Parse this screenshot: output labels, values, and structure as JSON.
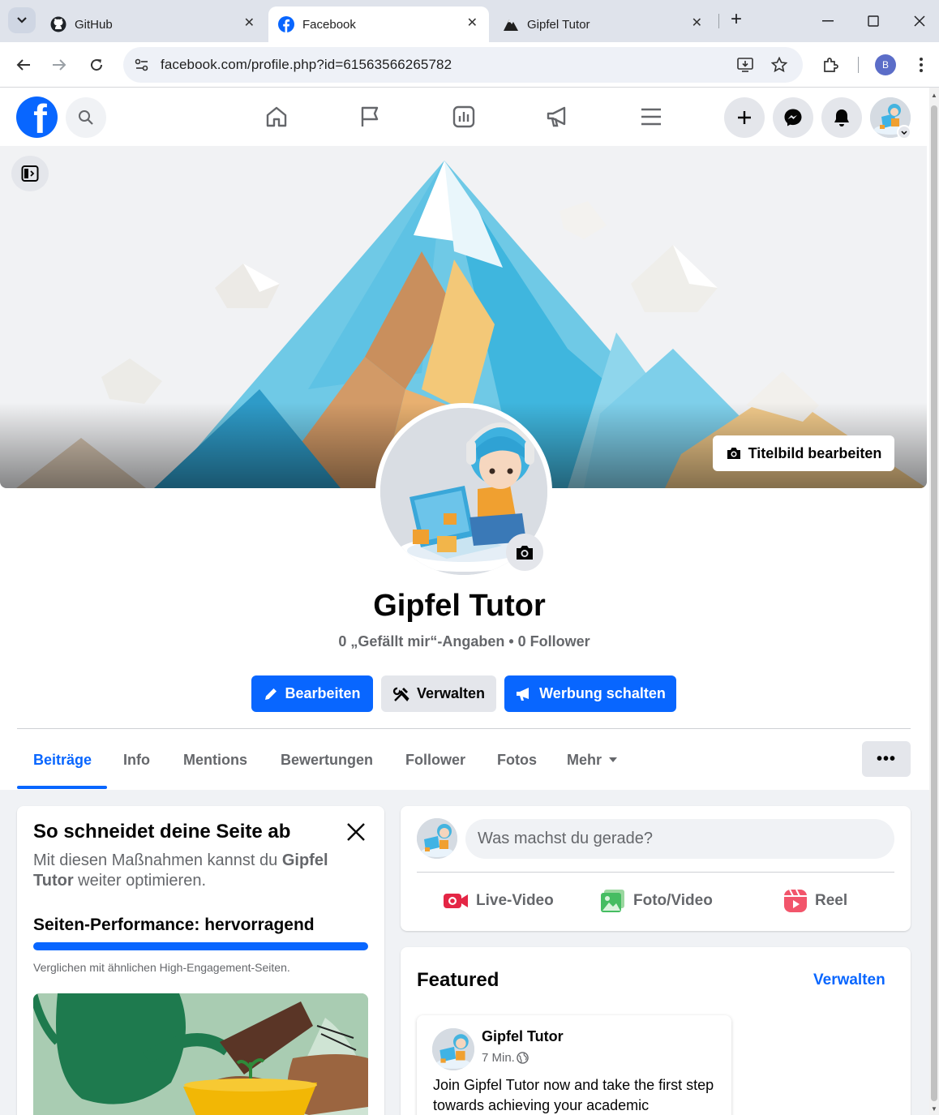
{
  "browser": {
    "tabs": [
      {
        "title": "GitHub",
        "icon": "github-icon"
      },
      {
        "title": "Facebook",
        "icon": "facebook-icon",
        "active": true
      },
      {
        "title": "Gipfel Tutor",
        "icon": "mountain-icon"
      }
    ],
    "new_tab": "+",
    "url": "facebook.com/profile.php?id=61563566265782",
    "profile_initial": "B"
  },
  "profile": {
    "name": "Gipfel Tutor",
    "stats": "0 „Gefällt mir“-Angaben • 0 Follower",
    "cover_edit_label": "Titelbild bearbeiten",
    "buttons": {
      "edit": "Bearbeiten",
      "manage": "Verwalten",
      "advertise": "Werbung schalten"
    },
    "tabs": [
      "Beiträge",
      "Info",
      "Mentions",
      "Bewertungen",
      "Follower",
      "Fotos",
      "Mehr"
    ],
    "more_dots": "•••"
  },
  "performance_card": {
    "title": "So schneidet deine Seite ab",
    "desc_pre": "Mit diesen Maßnahmen kannst du ",
    "desc_bold": "Gipfel Tutor",
    "desc_post": " weiter optimieren.",
    "performance": "Seiten-Performance: hervorragend",
    "performance_level": 1.0,
    "note": "Verglichen mit ähnlichen High-Engagement-Seiten."
  },
  "composer": {
    "placeholder": "Was machst du gerade?",
    "actions": [
      "Live-Video",
      "Foto/Video",
      "Reel"
    ]
  },
  "featured": {
    "title": "Featured",
    "manage": "Verwalten",
    "post": {
      "author": "Gipfel Tutor",
      "time": "7 Min.",
      "text": "Join Gipfel Tutor now and take the first step towards achieving your academic"
    }
  },
  "colors": {
    "fb_blue": "#0866ff",
    "secondary_text": "#65676b",
    "button_gray": "#e4e6eb"
  }
}
